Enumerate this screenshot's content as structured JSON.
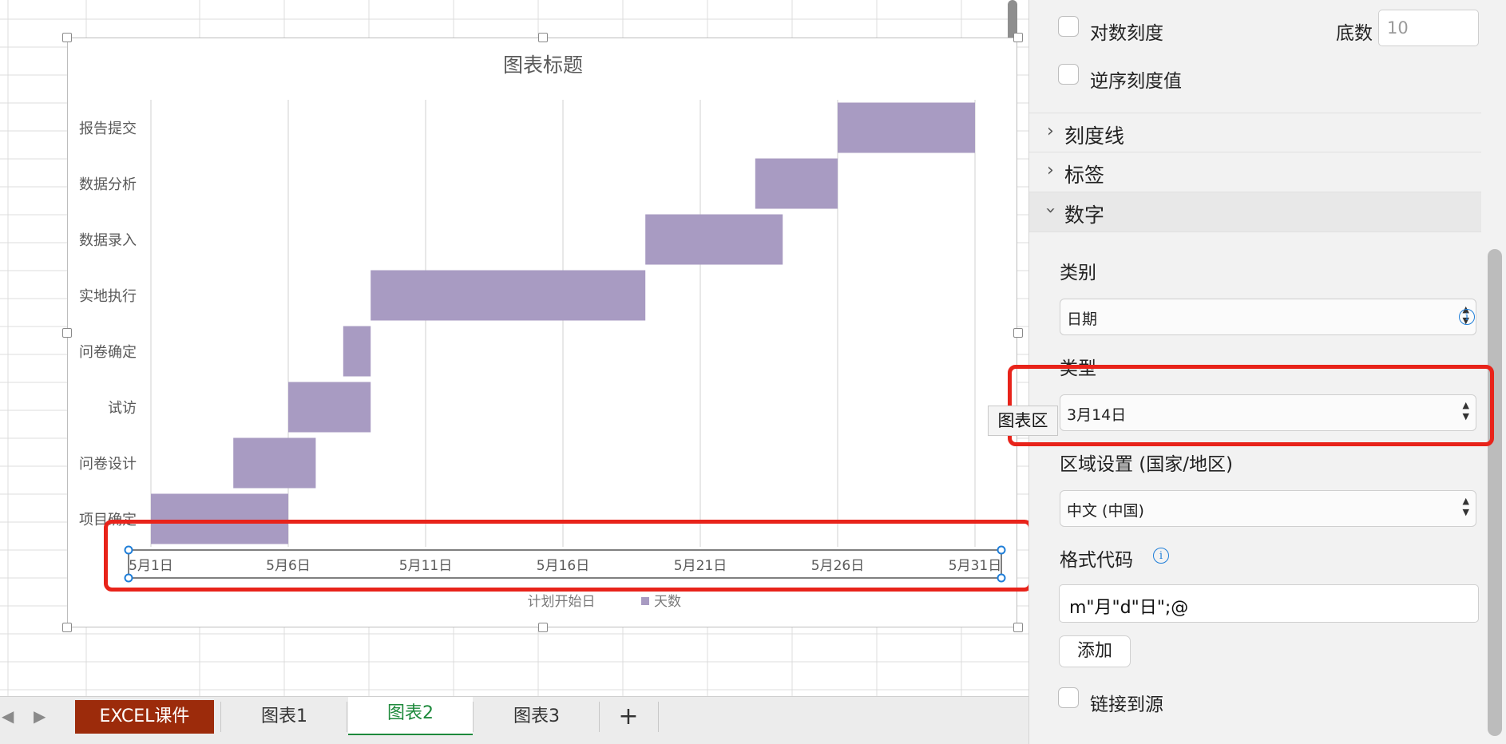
{
  "chart": {
    "title": "图表标题",
    "legend": {
      "series1": "计划开始日",
      "series2": "天数"
    },
    "tooltip": "图表区"
  },
  "chart_data": {
    "type": "bar",
    "orientation": "horizontal-stacked-gantt",
    "title": "图表标题",
    "categories": [
      "报告提交",
      "数据分析",
      "数据录入",
      "实地执行",
      "问卷确定",
      "试访",
      "问卷设计",
      "项目确定"
    ],
    "series": [
      {
        "name": "计划开始日",
        "start": [
          "2024-05-26",
          "2024-05-23",
          "2024-05-19",
          "2024-05-09",
          "2024-05-08",
          "2024-05-06",
          "2024-05-04",
          "2024-05-01"
        ],
        "visible": false
      },
      {
        "name": "天数",
        "values": [
          5,
          3,
          5,
          10,
          1,
          3,
          3,
          5
        ],
        "color": "#a89bc2"
      }
    ],
    "x_ticks": [
      "5月1日",
      "5月6日",
      "5月11日",
      "5月16日",
      "5月21日",
      "5月26日",
      "5月31日"
    ],
    "xlim": [
      "2024-05-01",
      "2024-05-31"
    ],
    "grid": "vertical",
    "legend_position": "bottom"
  },
  "panel": {
    "log_scale_label": "对数刻度",
    "base_label": "底数",
    "base_value": "10",
    "reverse_label": "逆序刻度值",
    "sections": {
      "ticks": "刻度线",
      "labels": "标签",
      "number": "数字"
    },
    "category_label": "类别",
    "category_value": "日期",
    "type_label": "类型",
    "type_value": "3月14日",
    "locale_label": "区域设置 (国家/地区)",
    "locale_value": "中文 (中国)",
    "format_label": "格式代码",
    "format_value": "m\"月\"d\"日\";@",
    "add_button": "添加",
    "link_source_label": "链接到源"
  },
  "tabs": [
    {
      "label": "EXCEL课件"
    },
    {
      "label": "图表1"
    },
    {
      "label": "图表2"
    },
    {
      "label": "图表3"
    }
  ],
  "tab_add": "+",
  "colors": {
    "bar": "#a89bc2",
    "highlight": "#e8231a",
    "active_tab_bg": "#9c2b0b",
    "active_sheet_text": "#1e8a3c"
  }
}
